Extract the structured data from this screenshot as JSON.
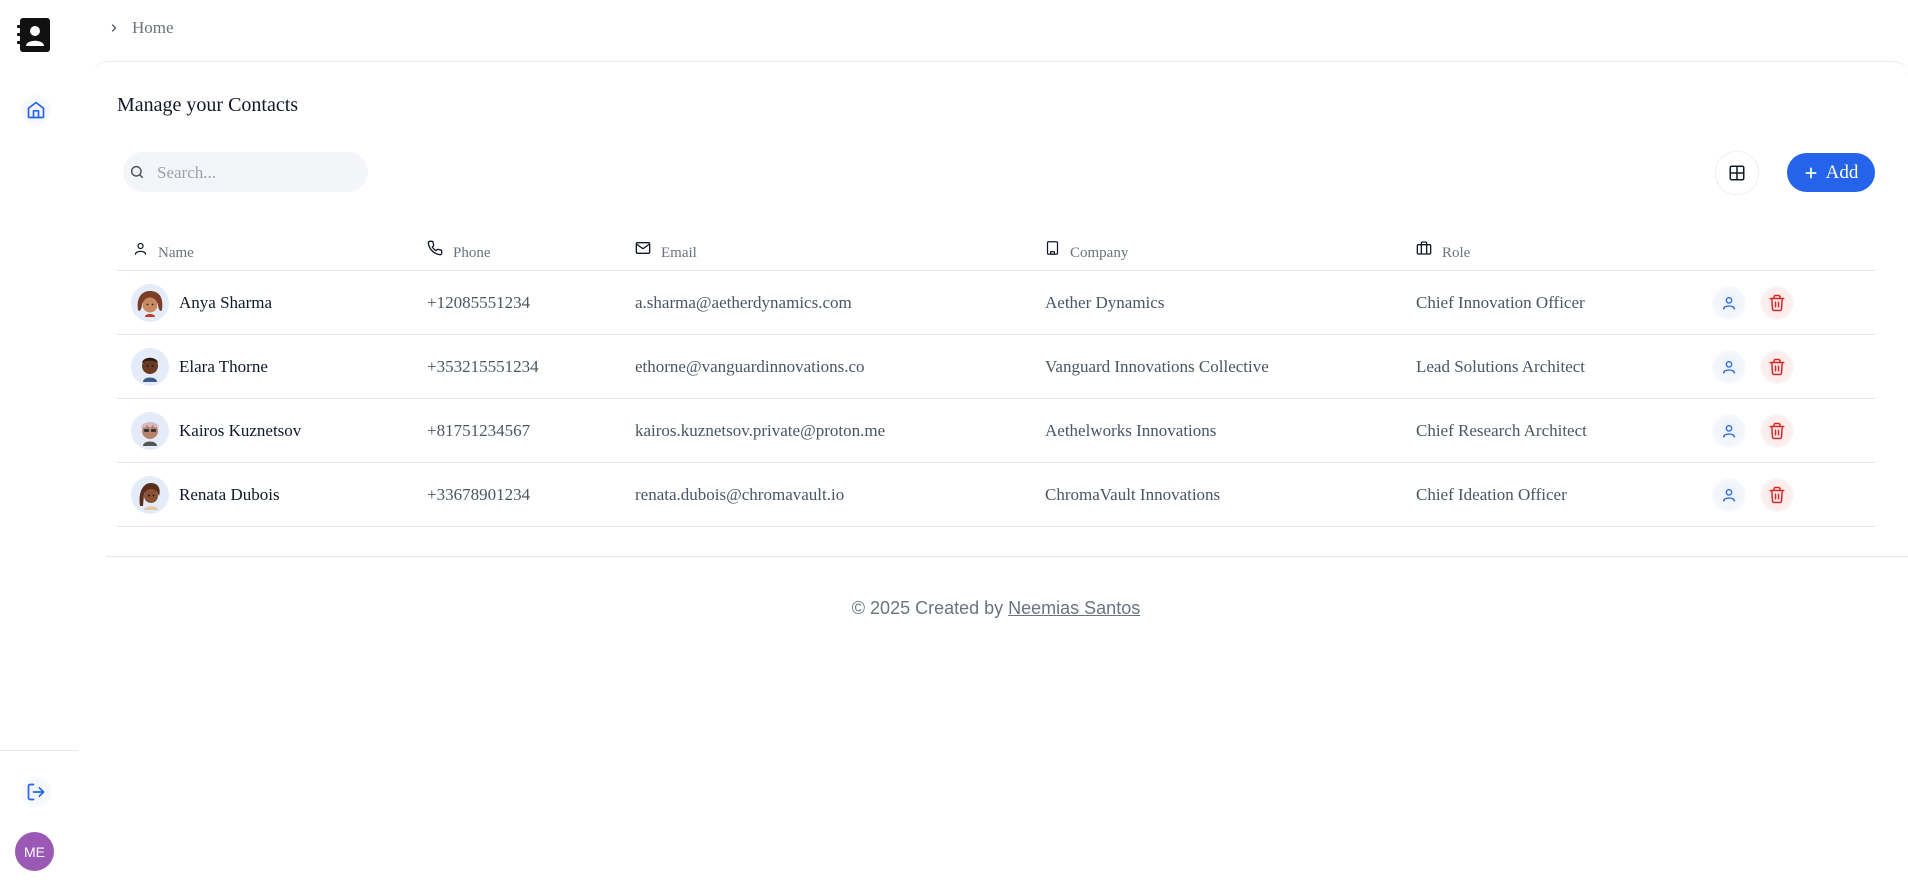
{
  "breadcrumb": {
    "items": [
      "Home"
    ]
  },
  "page": {
    "title": "Manage your Contacts"
  },
  "search": {
    "placeholder": "Search...",
    "value": ""
  },
  "toolbar": {
    "add_label": "Add"
  },
  "table": {
    "columns": [
      "Name",
      "Phone",
      "Email",
      "Company",
      "Role"
    ],
    "rows": [
      {
        "name": "Anya Sharma",
        "phone": "+12085551234",
        "email": "a.sharma@aetherdynamics.com",
        "company": "Aether Dynamics",
        "role": "Chief Innovation Officer"
      },
      {
        "name": "Elara Thorne",
        "phone": "+353215551234",
        "email": "ethorne@vanguardinnovations.co",
        "company": "Vanguard Innovations Collective",
        "role": "Lead Solutions Architect"
      },
      {
        "name": "Kairos Kuznetsov",
        "phone": "+81751234567",
        "email": "kairos.kuznetsov.private@proton.me",
        "company": "Aethelworks Innovations",
        "role": "Chief Research Architect"
      },
      {
        "name": "Renata Dubois",
        "phone": "+33678901234",
        "email": "renata.dubois@chromavault.io",
        "company": "ChromaVault Innovations",
        "role": "Chief Ideation Officer"
      }
    ]
  },
  "footer": {
    "prefix": "© 2025 Created by ",
    "author": "Neemias Santos"
  },
  "user": {
    "initials": "ME"
  },
  "colors": {
    "accent": "#2563eb",
    "danger": "#dc2626",
    "avatar_bg": "#9b59b6"
  }
}
